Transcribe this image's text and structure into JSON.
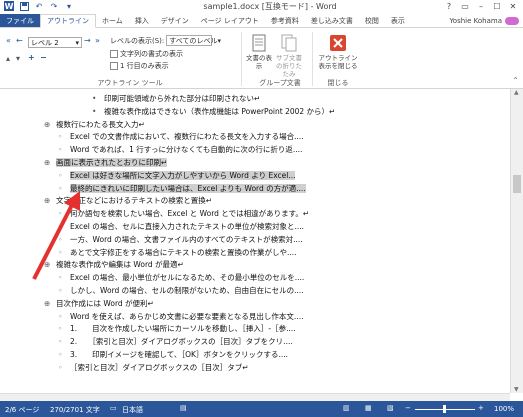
{
  "title": "sample1.docx [互換モード] - Word",
  "window_controls": [
    "?",
    "▭",
    "–",
    "☐",
    "✕"
  ],
  "tabs": [
    "ファイル",
    "アウトライン",
    "ホーム",
    "挿入",
    "デザイン",
    "ページ レイアウト",
    "参考資料",
    "差し込み文書",
    "校閲",
    "表示"
  ],
  "user": "Yoshie Kohama",
  "ribbon": {
    "level_value": "レベル 2",
    "show_level_label": "レベルの表示(S):",
    "show_level_value": "すべてのレベル",
    "show_format_label": "文字列の書式の表示",
    "first_line_label": "1 行目のみ表示",
    "outline_tools_label": "アウトライン ツール",
    "show_doc_label": "文書の表示",
    "collapse_sub_label": "サブ文書の折りたたみ",
    "master_doc_label": "グループ文書",
    "close_outline_label": "アウトライン表示を閉じる",
    "close_group_label": "閉じる"
  },
  "doc_lines": [
    {
      "level": 2,
      "bullet": "•",
      "text": "印刷可能領域から外れた部分は印刷されない↵",
      "hl": false
    },
    {
      "level": 2,
      "bullet": "•",
      "text": "複雑な表作成はできない（表作成機能は PowerPoint 2002 から）↵",
      "hl": false
    },
    {
      "level": 0,
      "bullet": "⊕",
      "text": "複数行にわたる長文入力↵",
      "hl": false
    },
    {
      "level": 1,
      "bullet": "◦",
      "text": "Excel での文書作成において、複数行にわたる長文を入力する場合....",
      "hl": false
    },
    {
      "level": 1,
      "bullet": "◦",
      "text": "Word であれば、1 行すっに分けなくても自動的に次の行に折り返....",
      "hl": false
    },
    {
      "level": 0,
      "bullet": "⊕",
      "text": "画面に表示されたとおりに印刷↵",
      "hl": true
    },
    {
      "level": 1,
      "bullet": "◦",
      "text": "Excel は好きな場所に文字入力がしやすいから Word より Excel...",
      "hl": true
    },
    {
      "level": 1,
      "bullet": "◦",
      "text": "最終的にきれいに印刷したい場合は、Excel よりも Word の方が適....",
      "hl": true
    },
    {
      "level": 0,
      "bullet": "⊕",
      "text": "文字修正などにおけるテキストの検索と置換↵",
      "hl": false
    },
    {
      "level": 1,
      "bullet": "◦",
      "text": "何か語句を検索したい場合、Excel と Word とでは相違があります。↵",
      "hl": false
    },
    {
      "level": 1,
      "bullet": "◦",
      "text": "Excel の場合、セルに直接入力されたテキストの単位が検索対象と....",
      "hl": false
    },
    {
      "level": 1,
      "bullet": "◦",
      "text": "一方、Word の場合、文書ファイル内のすべてのテキストが検索対....",
      "hl": false
    },
    {
      "level": 1,
      "bullet": "◦",
      "text": "あとで文字修正をする場合にテキストの検索と置換の作業がしや....",
      "hl": false
    },
    {
      "level": 0,
      "bullet": "⊕",
      "text": "複雑な表作成や編集は Word が最適↵",
      "hl": false
    },
    {
      "level": 1,
      "bullet": "◦",
      "text": "Excel の場合、最小単位がセルになるため、その最小単位のセルを....",
      "hl": false
    },
    {
      "level": 1,
      "bullet": "◦",
      "text": "しかし、Word の場合、セルの制限がないため、自由自在にセルの....",
      "hl": false
    },
    {
      "level": 0,
      "bullet": "⊕",
      "text": "目次作成には Word が便利↵",
      "hl": false
    },
    {
      "level": 1,
      "bullet": "◦",
      "text": "Word を使えば、あらかじめ文書に必要な要素となる見出し作本文....",
      "hl": false
    },
    {
      "level": 1,
      "bullet": "◦",
      "text": "1.　　目次を作成したい場所にカーソルを移動し、［挿入］-［参....",
      "hl": false
    },
    {
      "level": 1,
      "bullet": "◦",
      "text": "2.　　［索引と目次］ダイアログボックスの［目次］タブをクリ....",
      "hl": false
    },
    {
      "level": 1,
      "bullet": "◦",
      "text": "3.　　印刷イメージを確認して、［OK］ボタンをクリックする....",
      "hl": false
    },
    {
      "level": 1,
      "bullet": "◦",
      "text": "［索引と目次］ダイアログボックスの［目次］タブ↵",
      "hl": false
    }
  ],
  "status": {
    "page": "2/6 ページ",
    "words": "270/2701 文字",
    "lang": "日本語",
    "zoom": "100%"
  },
  "colors": {
    "accent": "#2b579a",
    "arrow": "#e53030",
    "highlight": "#cfcfcf"
  }
}
